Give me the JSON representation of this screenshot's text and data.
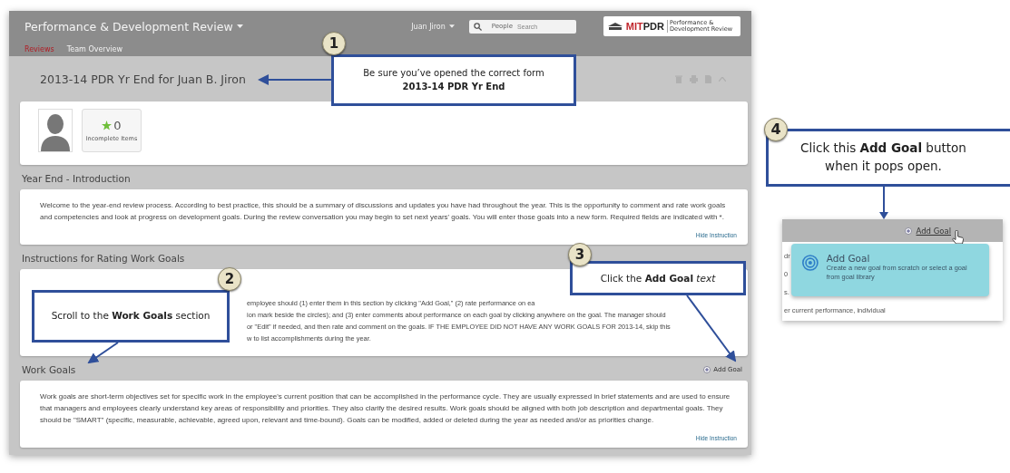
{
  "header": {
    "title": "Performance & Development Review",
    "user": "Juan Jiron",
    "search": {
      "scope": "People",
      "placeholder": "Search"
    },
    "logo": {
      "prefix": "MIT",
      "name": "PDR",
      "tagline": "Performance & Development Review"
    }
  },
  "tabs": [
    {
      "label": "Reviews",
      "selected": true
    },
    {
      "label": "Team Overview",
      "selected": false
    }
  ],
  "form": {
    "title": "2013-14 PDR Yr End for Juan B. Jiron",
    "incomplete": {
      "count": "0",
      "label": "Incomplete Items"
    }
  },
  "sections": [
    {
      "heading": "Year End - Introduction",
      "text": "Welcome to the year-end review process. According to best practice, this should be a summary of discussions and updates you have had throughout the year. This is the opportunity to comment and rate work goals and competencies and look at progress on development goals. During the review conversation you may begin to set next years' goals. You will enter those goals into a new form. Required fields are indicated with *.",
      "link": "Hide Instruction"
    },
    {
      "heading": "Instructions for Rating Work Goals",
      "lines": [
        "employee should (1) enter them in this section by clicking \"Add Goal,\" (2) rate performance on ea",
        "ion mark beside the circles); and (3) enter comments about performance on each goal by clicking anywhere on the goal. The manager should",
        "or \"Edit\" if needed, and then rate and comment on the goals. IF THE EMPLOYEE DID NOT HAVE ANY WORK GOALS FOR 2013-14, skip this",
        "w to list accomplishments during the year."
      ]
    },
    {
      "heading": "Work Goals",
      "action": "Add Goal",
      "text": "Work goals are short-term objectives set for specific work in the employee's current position that can be accomplished in the performance cycle. They are usually expressed in brief statements and are used to ensure that managers and employees clearly understand key areas of responsibility and priorities. They also clarify the desired results. Work goals should be aligned with both job description and departmental goals. They should be \"SMART\" (specific, measurable, achievable, agreed upon, relevant and time-bound). Goals can be modified, added or deleted during the year as needed and/or as priorities change.",
      "link": "Hide Instruction"
    }
  ],
  "callouts": [
    {
      "number": "1",
      "lines": [
        "Be sure you’ve opened the correct form",
        "**2013-14 PDR Yr End**"
      ]
    },
    {
      "number": "2",
      "lines": [
        "Scroll to the **Work Goals** section"
      ]
    },
    {
      "number": "3",
      "lines": [
        "Click the **Add Goal** *text*"
      ]
    }
  ],
  "inset": {
    "callout": {
      "number": "4",
      "lines": [
        "Click this **Add Goal** button",
        "when it pops open."
      ]
    },
    "action": "Add Goal",
    "popup": {
      "title": "Add Goal",
      "description": "Create a new goal from scratch or select a goal from goal library"
    },
    "fragments": [
      "dr",
      "0",
      "s.",
      "er current performance, individual"
    ]
  }
}
